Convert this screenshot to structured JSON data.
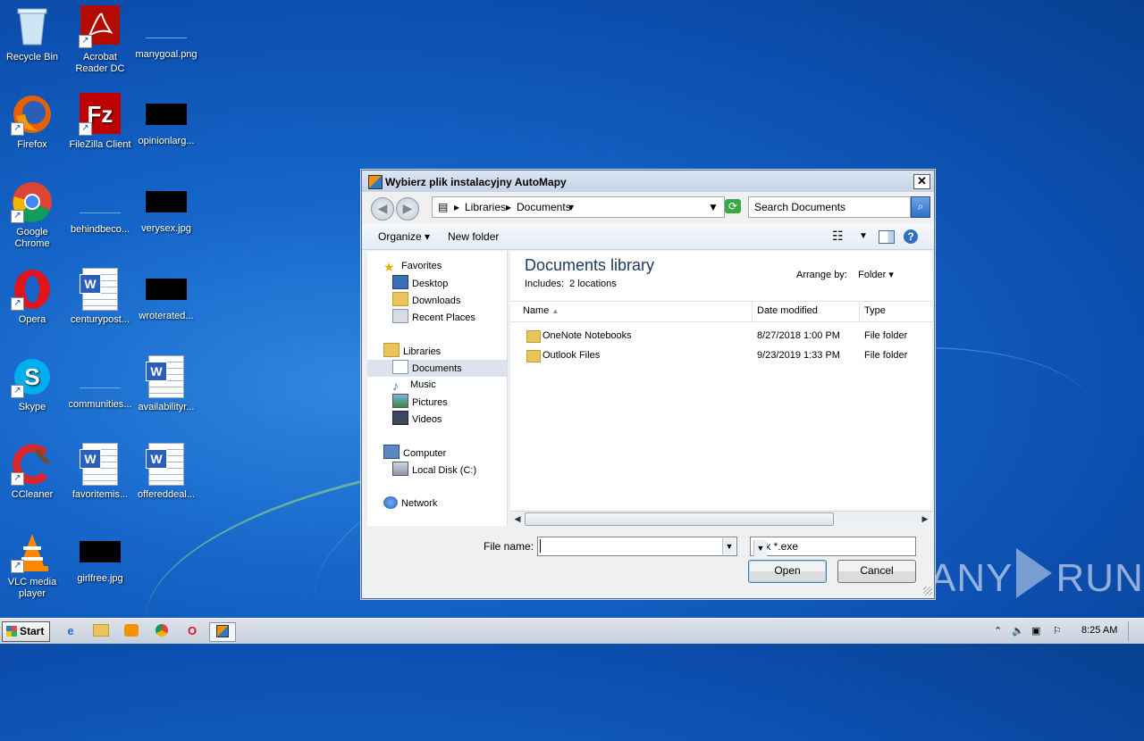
{
  "desktop": {
    "icons": [
      {
        "name": "recycle-bin",
        "label": "Recycle Bin"
      },
      {
        "name": "acrobat",
        "label": "Acrobat Reader DC"
      },
      {
        "name": "manygoal",
        "label": "manygoal.png"
      },
      {
        "name": "firefox",
        "label": "Firefox"
      },
      {
        "name": "filezilla",
        "label": "FileZilla Client"
      },
      {
        "name": "opinionlarg",
        "label": "opinionlarg..."
      },
      {
        "name": "chrome",
        "label": "Google Chrome"
      },
      {
        "name": "behindbeco",
        "label": "behindbeco..."
      },
      {
        "name": "verysex",
        "label": "verysex.jpg"
      },
      {
        "name": "opera",
        "label": "Opera"
      },
      {
        "name": "centurypost",
        "label": "centurypost..."
      },
      {
        "name": "wroterated",
        "label": "wroterated..."
      },
      {
        "name": "skype",
        "label": "Skype"
      },
      {
        "name": "communities",
        "label": "communities..."
      },
      {
        "name": "availabilityr",
        "label": "availabilityr..."
      },
      {
        "name": "ccleaner",
        "label": "CCleaner"
      },
      {
        "name": "favoritemis",
        "label": "favoritemis..."
      },
      {
        "name": "offereddeal",
        "label": "offereddeal..."
      },
      {
        "name": "vlc",
        "label": "VLC media player"
      },
      {
        "name": "girlfree",
        "label": "girlfree.jpg"
      }
    ]
  },
  "dialog": {
    "title": "Wybierz plik instalacyjny AutoMapy",
    "close": "✕",
    "breadcrumb": [
      "Libraries",
      "Documents"
    ],
    "search_placeholder": "Search Documents",
    "toolbar": {
      "organize": "Organize",
      "new_folder": "New folder"
    },
    "nav": {
      "favorites": "Favorites",
      "desktop": "Desktop",
      "downloads": "Downloads",
      "recent_places": "Recent Places",
      "libraries": "Libraries",
      "documents": "Documents",
      "music": "Music",
      "pictures": "Pictures",
      "videos": "Videos",
      "computer": "Computer",
      "local_disk": "Local Disk (C:)",
      "network": "Network"
    },
    "library": {
      "title": "Documents library",
      "includes_label": "Includes:",
      "includes_value": "2 locations",
      "arrange_label": "Arrange by:",
      "arrange_value": "Folder"
    },
    "columns": {
      "name": "Name",
      "date": "Date modified",
      "type": "Type"
    },
    "rows": [
      {
        "name": "OneNote Notebooks",
        "date": "8/27/2018 1:00 PM",
        "type": "File folder"
      },
      {
        "name": "Outlook Files",
        "date": "9/23/2019 1:33 PM",
        "type": "File folder"
      }
    ],
    "file_name_label": "File name:",
    "file_name_value": "",
    "file_type": "Plik *.exe",
    "open": "Open",
    "cancel": "Cancel"
  },
  "watermark": {
    "left": "ANY",
    "right": "RUN"
  },
  "taskbar": {
    "start": "Start",
    "clock": "8:25 AM"
  }
}
